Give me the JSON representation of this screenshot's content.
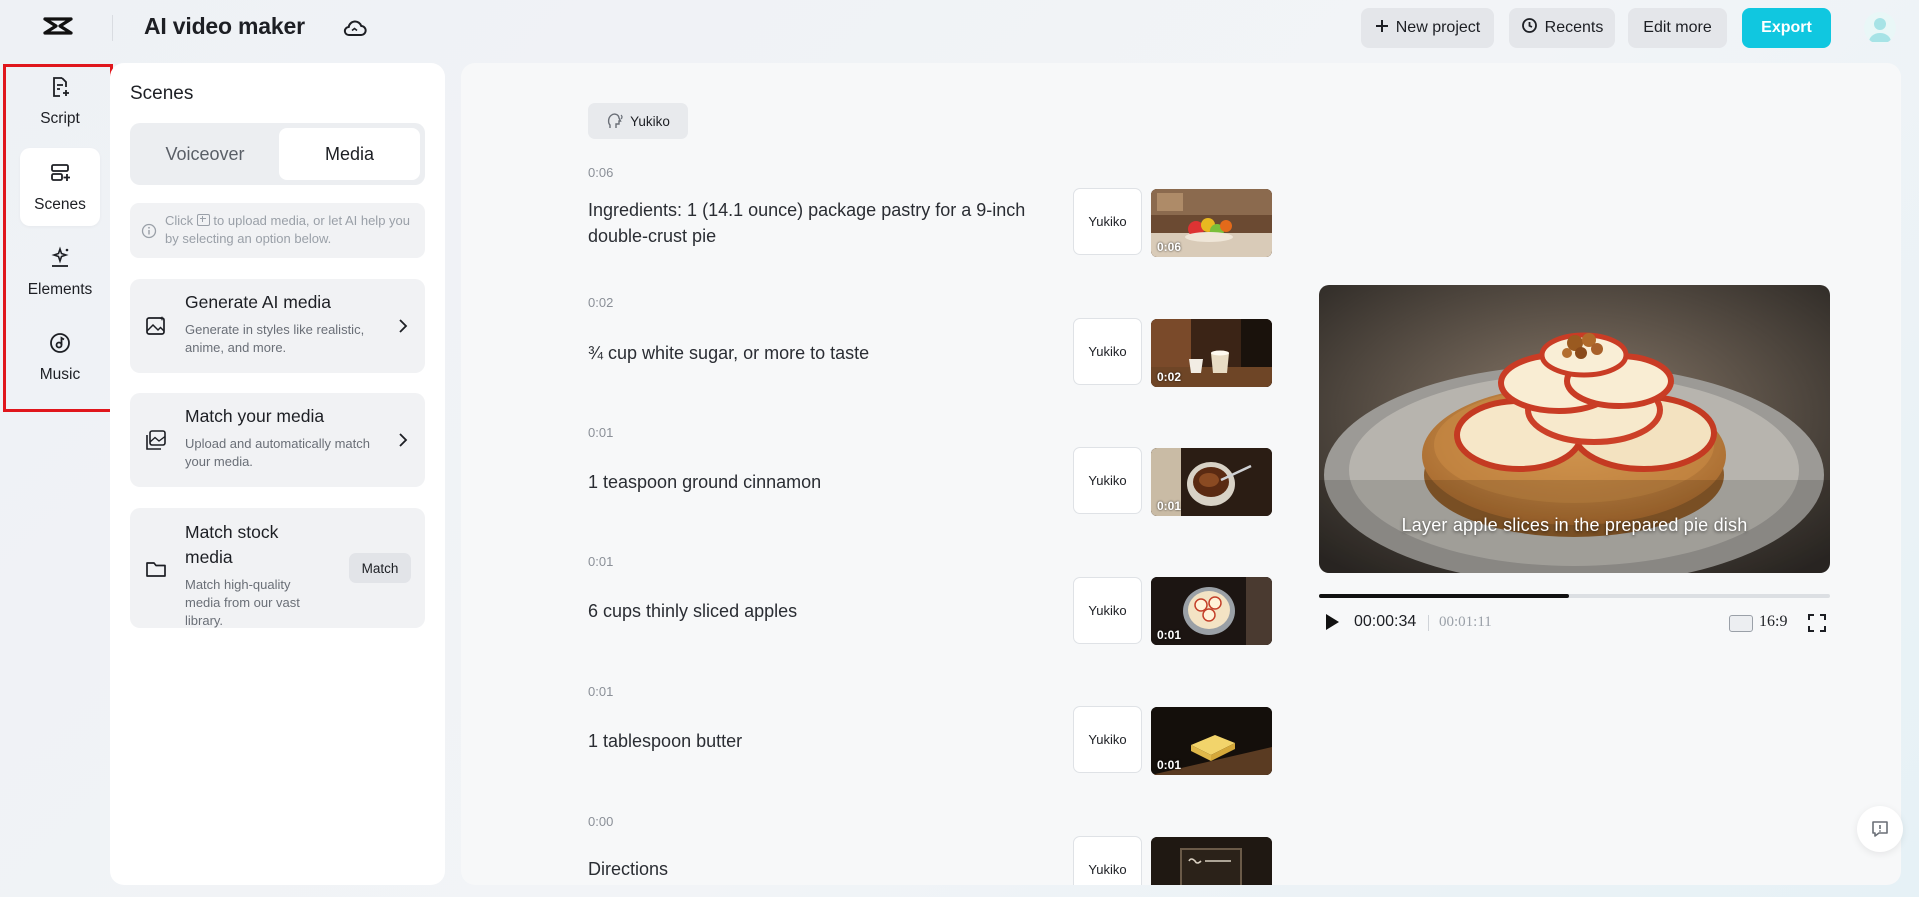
{
  "header": {
    "app_title": "AI video maker",
    "new_project": "New project",
    "recents": "Recents",
    "edit_more": "Edit more",
    "export": "Export"
  },
  "rail": {
    "items": [
      {
        "label": "Script",
        "icon": "script-add-icon"
      },
      {
        "label": "Scenes",
        "icon": "scenes-icon",
        "active": true
      },
      {
        "label": "Elements",
        "icon": "elements-icon"
      },
      {
        "label": "Music",
        "icon": "music-icon"
      }
    ]
  },
  "panel": {
    "title": "Scenes",
    "tabs": [
      "Voiceover",
      "Media"
    ],
    "active_tab": "Media",
    "hint_pre": "Click",
    "hint_post": "to upload media, or let AI help you by selecting an option below.",
    "cards": [
      {
        "title": "Generate AI media",
        "desc": "Generate in styles like realistic, anime, and more."
      },
      {
        "title": "Match your media",
        "desc": "Upload and automatically match your media."
      },
      {
        "title": "Match stock media",
        "desc": "Match high-quality media from our vast library.",
        "button": "Match"
      }
    ]
  },
  "main": {
    "voice_chip": "Yukiko",
    "scenes": [
      {
        "time": "0:06",
        "text": "Ingredients: 1 (14.1 ounce) package pastry for a 9-inch double-crust pie",
        "voice": "Yukiko",
        "duration": "0:06"
      },
      {
        "time": "0:02",
        "text": "¾ cup white sugar, or more to taste",
        "voice": "Yukiko",
        "duration": "0:02"
      },
      {
        "time": "0:01",
        "text": "1 teaspoon ground cinnamon",
        "voice": "Yukiko",
        "duration": "0:01"
      },
      {
        "time": "0:01",
        "text": "6 cups thinly sliced apples",
        "voice": "Yukiko",
        "duration": "0:01"
      },
      {
        "time": "0:01",
        "text": "1 tablespoon butter",
        "voice": "Yukiko",
        "duration": "0:01"
      },
      {
        "time": "0:00",
        "text": "Directions",
        "voice": "Yukiko",
        "duration": ""
      }
    ]
  },
  "preview": {
    "caption": "Layer apple slices in the prepared pie dish",
    "current_time": "00:00:34",
    "total_time": "00:01:11",
    "progress": 0.49,
    "aspect_ratio": "16:9"
  },
  "colors": {
    "accent": "#10c7e0",
    "highlight_border": "#e0161c"
  }
}
